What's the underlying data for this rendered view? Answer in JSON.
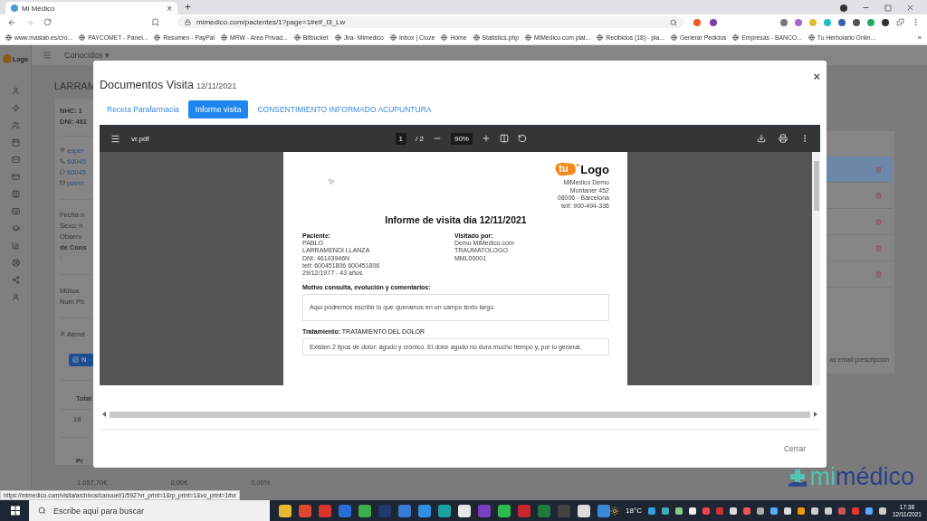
{
  "browser": {
    "tab": {
      "title": "Mi Médico",
      "close": "×"
    },
    "new_tab": "+",
    "url": "mimedico.com/pacientes/1?page=1#elf_l3_Lw",
    "bookmarks": [
      "www.maslab.es/cro...",
      "PAYCOMET - Panel...",
      "Resumen - PayPal",
      "MRW - Area Privad...",
      "Bitbucket",
      "Jira- Mimedico",
      "Inbox | Cloze",
      "Home",
      "Statistics.php",
      "MiMédico.com plat...",
      "Recibidos (18) - pla...",
      "Generar Pedidos",
      "Empresas - BANCO...",
      "Tu Herbolario Onlin..."
    ],
    "more_bookmarks": "»",
    "status_url": "https://mimedico.com/visita/archivos/canuuel/1/592?vr_print=1&rp_print=1&vo_print=1#vr"
  },
  "app": {
    "logo": "Logo",
    "menu": "Conocidos ▾",
    "patient_heading": "LARRAM",
    "ids": [
      "NHC: 1",
      "DNI: 461"
    ],
    "contacts": [
      {
        "kind": "location",
        "text": "esper"
      },
      {
        "kind": "phone",
        "text": "60045"
      },
      {
        "kind": "whatsapp",
        "text": "60045"
      },
      {
        "kind": "email",
        "text": "piarm"
      }
    ],
    "details": [
      "Fecha n",
      "Sexo: h",
      "Observ",
      "de Cons",
      ":"
    ],
    "insurance": [
      "Mútua: ",
      "Num Pó"
    ],
    "attended": "Atend",
    "new_button": "N",
    "table": {
      "header": "Total",
      "cell": "18"
    },
    "summary": {
      "header": "Pr",
      "values": [
        "1.057,70€",
        "0,00€",
        "0,00%"
      ]
    },
    "right_rows": [
      {
        "selected": true
      },
      {
        "selected": false
      },
      {
        "selected": false
      },
      {
        "selected": false
      },
      {
        "selected": false
      }
    ],
    "right_note": "as email prescripción",
    "brand": {
      "prefix": "mi",
      "name": "médico"
    }
  },
  "modal": {
    "title": "Documentos Visita",
    "date": "12/11/2021",
    "close": "×",
    "tabs": [
      {
        "label": "Receta Parafarmacia",
        "selected": false
      },
      {
        "label": "Informe visita",
        "selected": true
      },
      {
        "label": "CONSENTIMIENTO INFORMADO ACUPUNTURA",
        "selected": false
      }
    ],
    "viewer": {
      "file": "vr.pdf",
      "page": "1",
      "pages": "/ 2",
      "zoom": "90%"
    },
    "document": {
      "logo_prefix": "tu",
      "logo": "Logo",
      "clinic": [
        "MiMedico Demo",
        "Muntaner 452",
        "08006 - Barcelona",
        "telf: 900-494-336"
      ],
      "heading": "Informe de visita día 12/11/2021",
      "patient": {
        "label": "Paciente:",
        "lines": [
          "PABLO",
          "LARRAMENDI LLANZA",
          "DNI: 46143946N",
          "telf: 600451806 600451806",
          "29/12/1977 - 43 años"
        ]
      },
      "visitor": {
        "label": "Visitado por:",
        "lines": [
          "Demo MiMedico.com",
          "TRAUMATOLOGO",
          "MML00001"
        ]
      },
      "sections": [
        {
          "title": "Motivo consulta, evolución y comentarios:",
          "text": "Aquí podremos escribir lo que queramos en un campo texto largo."
        },
        {
          "title": "**Tratamiento:** TRATAMIENTO DEL DOLOR",
          "text": "Existen 2 tipos de dolor: agudo y crónico. El dolor agudo no dura mucho tiempo y, por lo general,"
        }
      ]
    },
    "close_button": "Cerrar"
  },
  "taskbar": {
    "search": "Escribe aquí para buscar",
    "weather": "18°C",
    "time": "17:38",
    "date": "12/11/2021"
  }
}
